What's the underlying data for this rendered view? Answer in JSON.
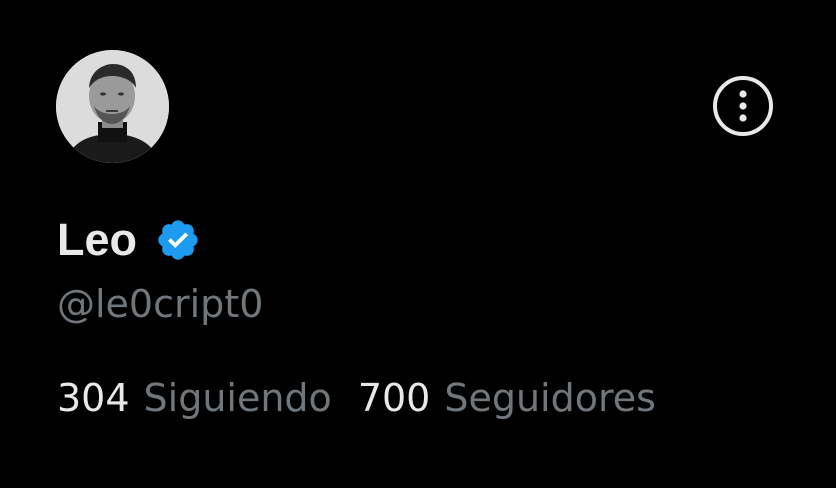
{
  "profile": {
    "display_name": "Leo",
    "handle": "@le0cript0",
    "verified": true,
    "verified_icon": "verified-badge-icon",
    "avatar_style": "grayscale portrait"
  },
  "stats": {
    "following_count": "304",
    "following_label": "Siguiendo",
    "followers_count": "700",
    "followers_label": "Seguidores"
  },
  "actions": {
    "more_icon": "more-options-icon"
  },
  "colors": {
    "background": "#000000",
    "primary_text": "#e7e9ea",
    "secondary_text": "#71767b",
    "verified_blue": "#1d9bf0"
  }
}
